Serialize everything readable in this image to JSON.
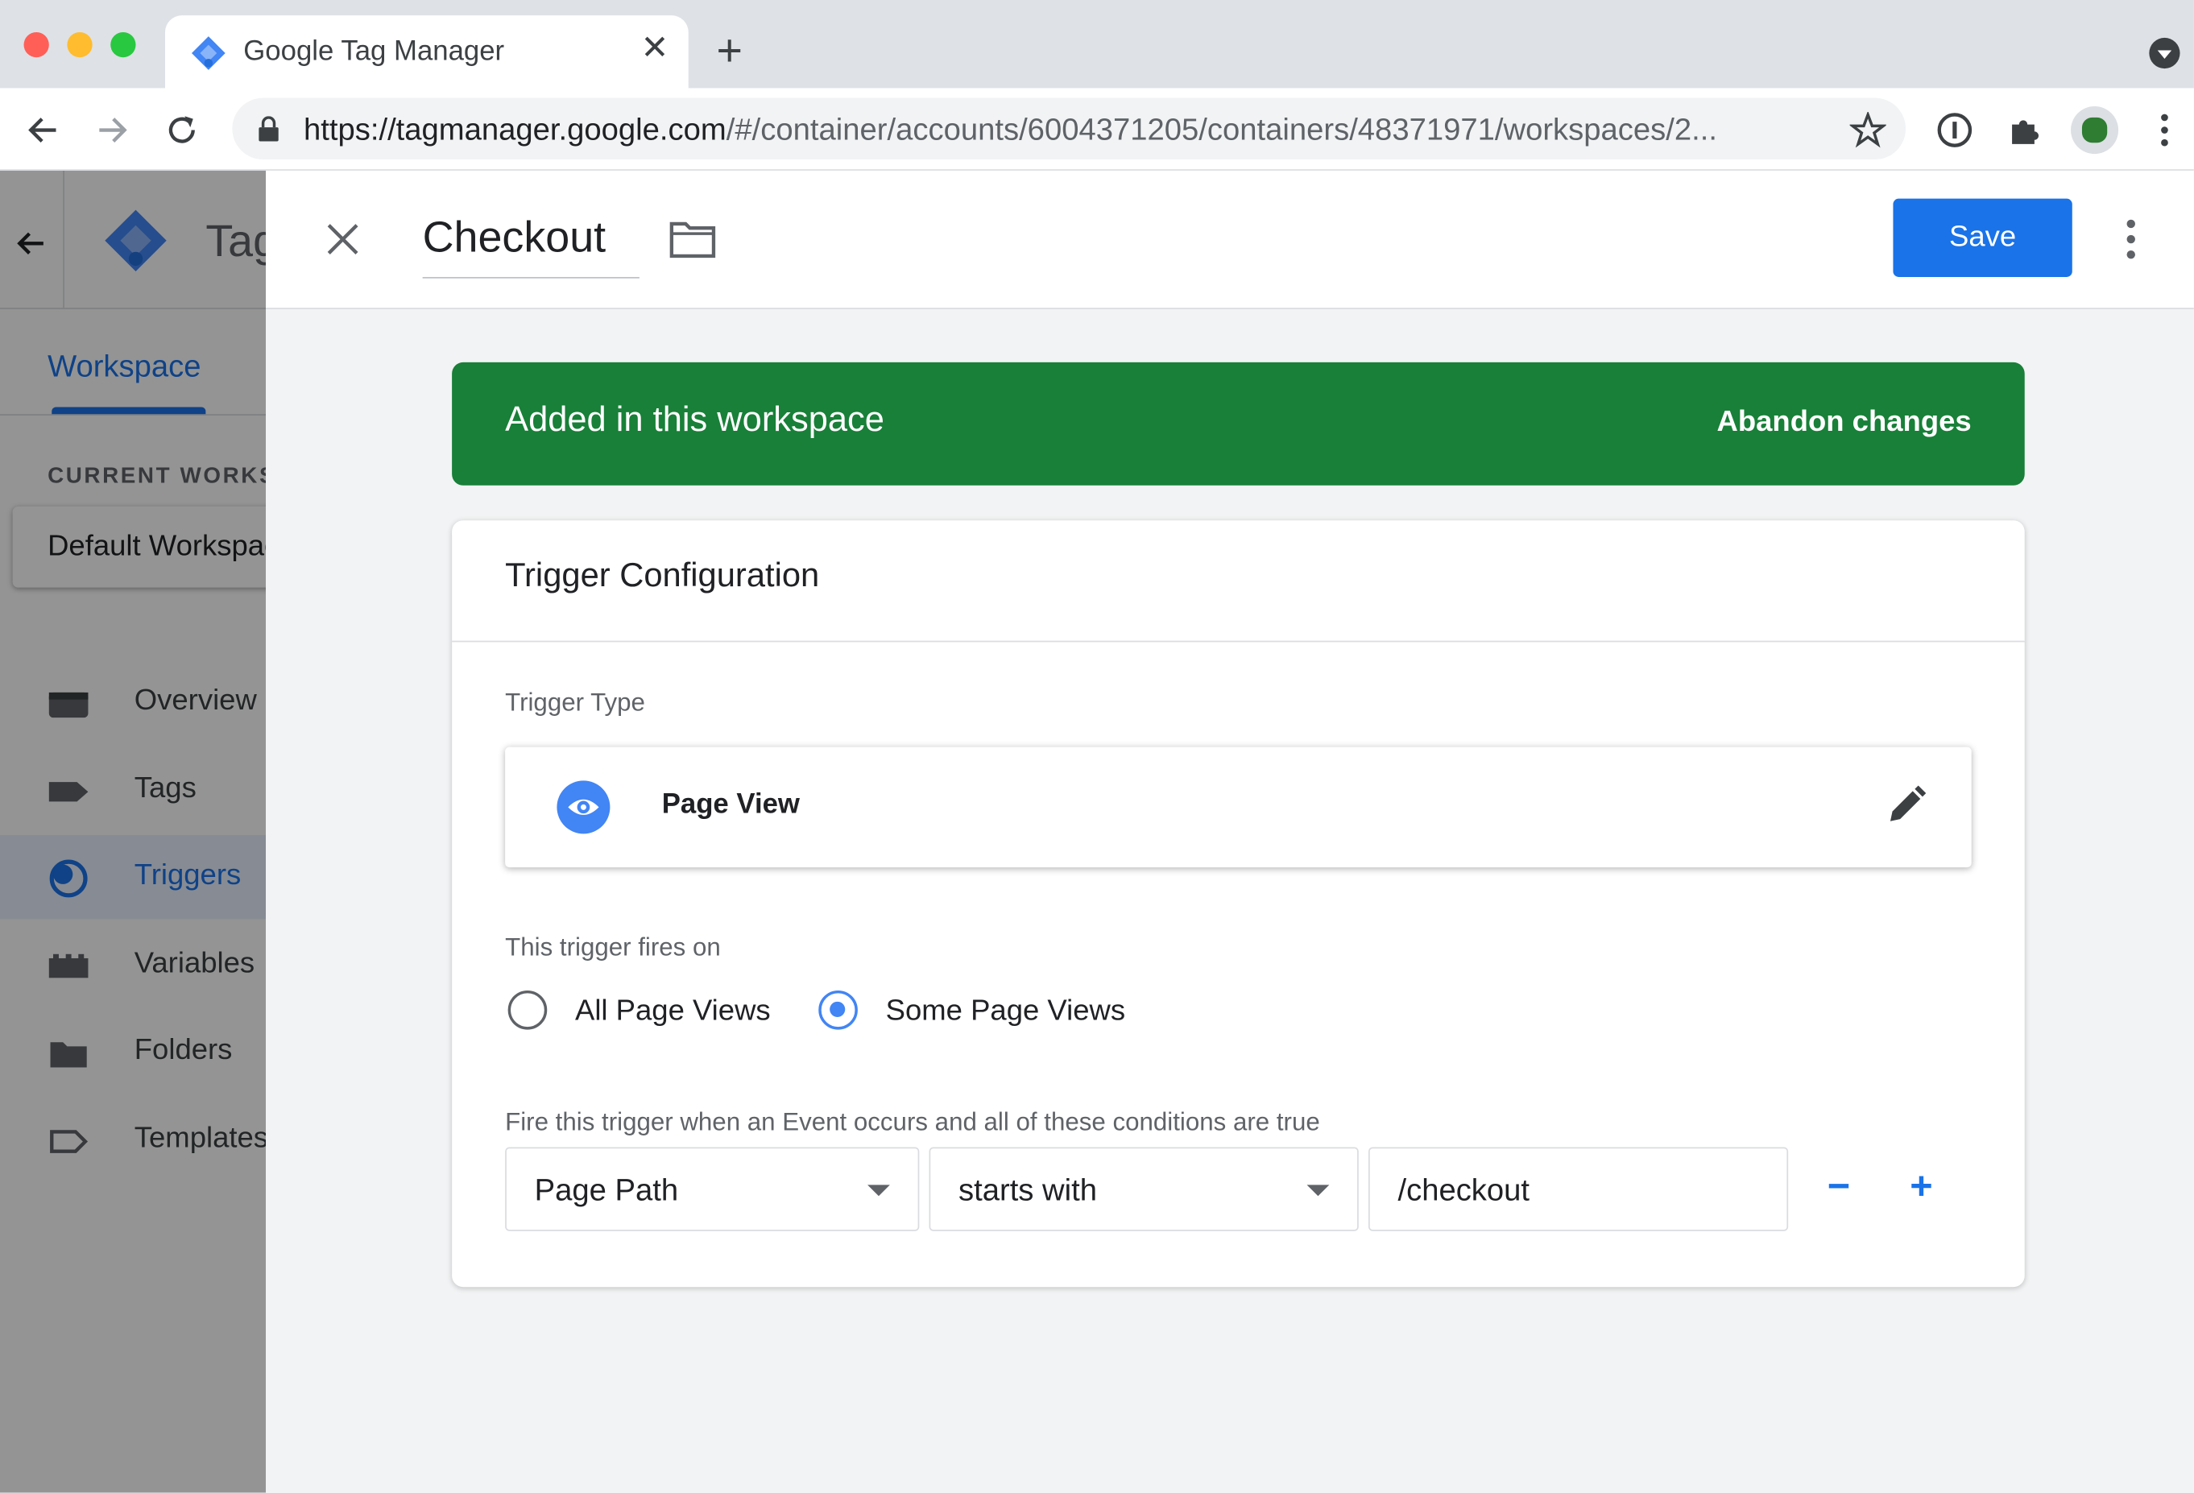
{
  "browser": {
    "tab_title": "Google Tag Manager",
    "tab_close": "✕",
    "new_tab": "+",
    "url_host": "https://tagmanager.google.com",
    "url_path": "/#/container/accounts/6004371205/containers/48371971/workspaces/2..."
  },
  "app": {
    "title_partial": "Tag",
    "workspace_tab": "Workspace",
    "current_workspace_label": "CURRENT WORKSPACE",
    "current_workspace": "Default Workspace",
    "nav": [
      {
        "label": "Overview",
        "icon": "overview-icon"
      },
      {
        "label": "Tags",
        "icon": "tag-icon"
      },
      {
        "label": "Triggers",
        "icon": "trigger-icon",
        "active": true
      },
      {
        "label": "Variables",
        "icon": "variables-icon"
      },
      {
        "label": "Folders",
        "icon": "folder-icon"
      },
      {
        "label": "Templates",
        "icon": "template-icon"
      }
    ]
  },
  "editor": {
    "title": "Checkout",
    "save_label": "Save",
    "banner": {
      "text": "Added in this workspace",
      "action": "Abandon changes"
    },
    "card": {
      "title": "Trigger Configuration",
      "trigger_type_label": "Trigger Type",
      "trigger_type": "Page View",
      "fires_on_label": "This trigger fires on",
      "options": [
        {
          "label": "All Page Views",
          "selected": false
        },
        {
          "label": "Some Page Views",
          "selected": true
        }
      ],
      "condition_label": "Fire this trigger when an Event occurs and all of these conditions are true",
      "condition": {
        "variable": "Page Path",
        "operator": "starts with",
        "value": "/checkout"
      },
      "remove_label": "−",
      "add_label": "+"
    }
  },
  "colors": {
    "accent": "#1a73e8",
    "banner": "#188038"
  }
}
